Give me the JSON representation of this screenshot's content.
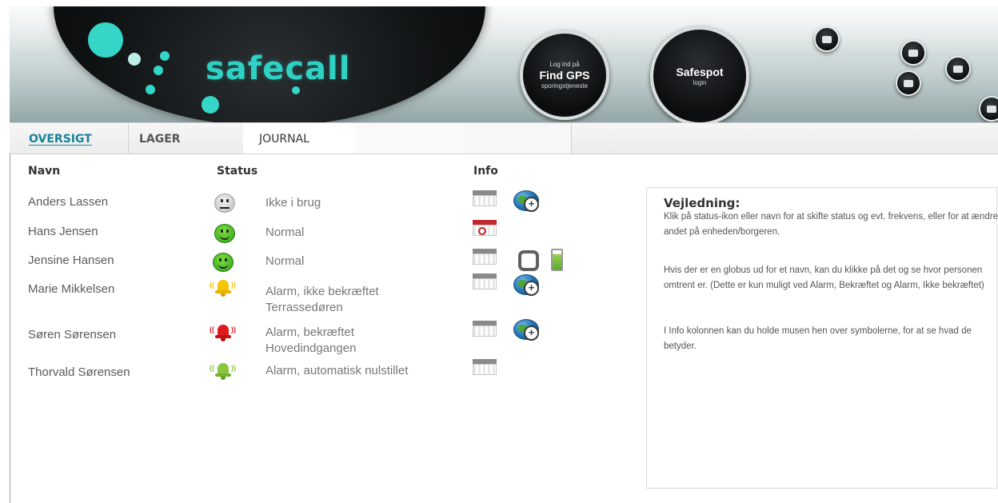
{
  "brand": {
    "name": "safecall"
  },
  "header": {
    "gps_button": {
      "line1": "Log ind på",
      "line2": "Find GPS",
      "line3": "sporingstjeneste"
    },
    "safespot_button": {
      "line1": "Safespot",
      "line2": "login"
    },
    "icons": [
      "help-icon",
      "mail-icon",
      "print-icon",
      "settings-icon",
      "user-icon"
    ]
  },
  "tabs": [
    {
      "label": "OVERSIGT",
      "active": true
    },
    {
      "label": "LAGER"
    },
    {
      "label": "JOURNAL"
    }
  ],
  "table": {
    "headers": {
      "name": "Navn",
      "status": "Status",
      "info": "Info"
    },
    "rows": [
      {
        "name": "Anders Lassen",
        "status": "Ikke i brug",
        "status_icon": "smiley-grey",
        "info_icons": [
          "calendar-icon",
          "globe-zoom-icon"
        ]
      },
      {
        "name": "Hans Jensen",
        "status": "Normal",
        "status_icon": "smiley-green",
        "info_icons": [
          "calendar-red-icon"
        ]
      },
      {
        "name": "Jensine Hansen",
        "status": "Normal",
        "status_icon": "smiley-green",
        "info_icons": [
          "calendar-icon",
          "device-icon",
          "battery-icon"
        ]
      },
      {
        "name": "Marie Mikkelsen",
        "status": "Alarm, ikke bekræftet",
        "status_sub": "Terrassedøren",
        "status_icon": "bell-yellow",
        "info_icons": [
          "calendar-icon",
          "globe-zoom-icon"
        ]
      },
      {
        "name": "Søren Sørensen",
        "status": "Alarm, bekræftet",
        "status_sub": "Hovedindgangen",
        "status_icon": "bell-red",
        "info_icons": [
          "calendar-icon",
          "globe-zoom-icon"
        ]
      },
      {
        "name": "Thorvald Sørensen",
        "status": "Alarm, automatisk nulstillet",
        "status_icon": "bell-green",
        "info_icons": [
          "calendar-icon"
        ]
      }
    ]
  },
  "help": {
    "title": "Vejledning:",
    "paragraphs": [
      "Klik på status-ikon eller navn for at skifte status og evt. frekvens, eller for at ændre andet på enheden/borgeren.",
      "Hvis der er en globus ud for et navn, kan du klikke på det og se hvor personen omtrent er. (Dette er kun muligt ved Alarm, Bekræftet og Alarm, Ikke bekræftet)",
      "I Info kolonnen kan du holde musen hen over symbolerne, for at se hvad de betyder."
    ]
  },
  "colors": {
    "accent": "#17839a",
    "brand_teal": "#2fd1c4",
    "alarm_yellow": "#f6c400",
    "alarm_red": "#e01b1b",
    "alarm_green": "#8cc63f",
    "ok_green": "#3cb521"
  }
}
